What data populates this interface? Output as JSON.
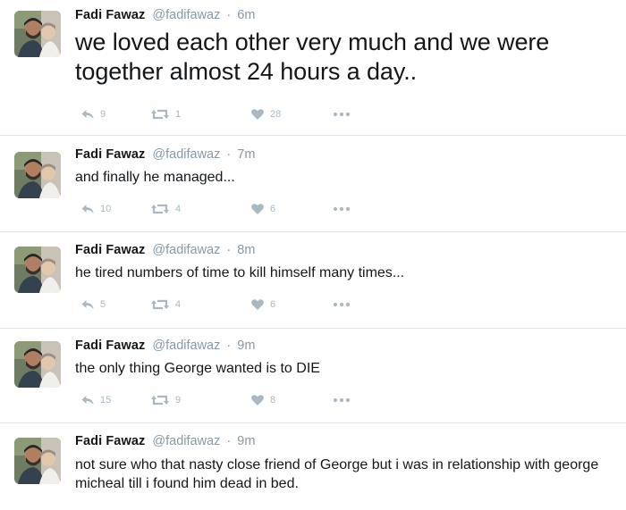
{
  "tweets": [
    {
      "name": "Fadi Fawaz",
      "handle": "@fadifawaz",
      "time": "6m",
      "text": "we loved each other very much and we were together almost 24 hours a day..",
      "replies": "9",
      "retweets": "1",
      "likes": "28"
    },
    {
      "name": "Fadi Fawaz",
      "handle": "@fadifawaz",
      "time": "7m",
      "text": "and finally he managed...",
      "replies": "10",
      "retweets": "4",
      "likes": "6"
    },
    {
      "name": "Fadi Fawaz",
      "handle": "@fadifawaz",
      "time": "8m",
      "text": "he tired numbers of time to kill himself many times...",
      "replies": "5",
      "retweets": "4",
      "likes": "6"
    },
    {
      "name": "Fadi Fawaz",
      "handle": "@fadifawaz",
      "time": "9m",
      "text": "the only thing George wanted is to DIE",
      "replies": "15",
      "retweets": "9",
      "likes": "8"
    },
    {
      "name": "Fadi Fawaz",
      "handle": "@fadifawaz",
      "time": "9m",
      "text": "not sure who that nasty close friend of George but i was in relationship with george micheal till i found him dead in bed."
    }
  ],
  "icons": {
    "reply": "reply-icon",
    "retweet": "retweet-icon",
    "like": "heart-icon",
    "more": "more-dots-icon"
  },
  "colors": {
    "text": "#14171a",
    "secondary": "#8899a6",
    "action": "#aab8c2",
    "divider": "#e1e8ed"
  }
}
